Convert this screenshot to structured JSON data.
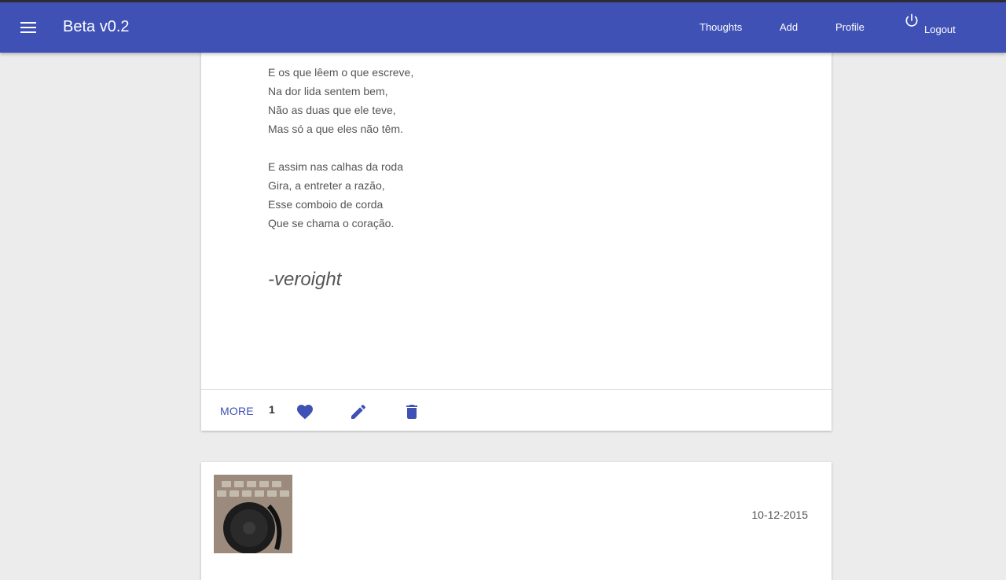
{
  "app": {
    "title": "Beta v0.2",
    "accent_color": "#3f51b5"
  },
  "nav": {
    "thoughts": "Thoughts",
    "add": "Add",
    "profile": "Profile",
    "logout": "Logout"
  },
  "icons": {
    "menu": "menu-icon",
    "logout": "power-icon",
    "like": "heart-icon",
    "edit": "pencil-icon",
    "delete": "trash-icon"
  },
  "post": {
    "stanzas": [
      [
        "E os que lêem o que escreve,",
        "Na dor lida sentem bem,",
        "Não as duas que ele teve,",
        "Mas só a que eles não têm."
      ],
      [
        "E assim nas calhas da roda",
        "Gira, a entreter a razão,",
        "Esse comboio de corda",
        "Que se chama o coração."
      ]
    ],
    "signature": "-veroight",
    "more_label": "MORE",
    "likes": "1"
  },
  "next_post": {
    "date": "10-12-2015"
  }
}
